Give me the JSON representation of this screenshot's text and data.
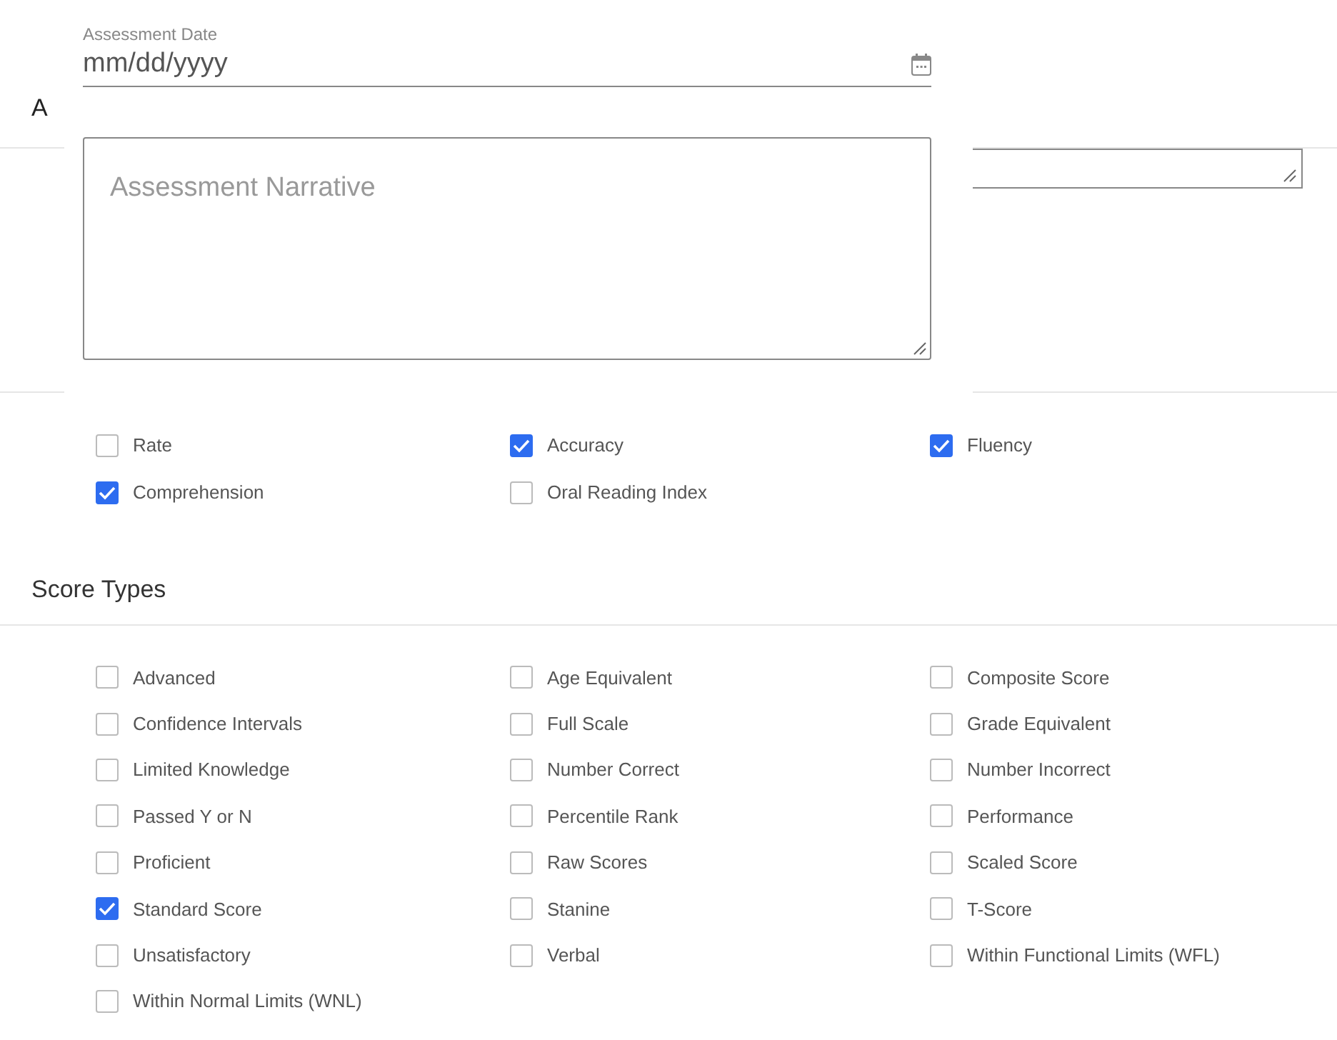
{
  "section_heading": "A",
  "date_field": {
    "label": "Assessment Date",
    "placeholder": "mm/dd/yyyy"
  },
  "narrative": {
    "placeholder": "Assessment Narrative"
  },
  "measures": [
    {
      "label": "Rate",
      "checked": false
    },
    {
      "label": "Accuracy",
      "checked": true
    },
    {
      "label": "Fluency",
      "checked": true
    },
    {
      "label": "Comprehension",
      "checked": true
    },
    {
      "label": "Oral Reading Index",
      "checked": false
    }
  ],
  "score_types": {
    "title": "Score Types",
    "items": [
      {
        "label": "Advanced",
        "checked": false
      },
      {
        "label": "Age Equivalent",
        "checked": false
      },
      {
        "label": "Composite Score",
        "checked": false
      },
      {
        "label": "Confidence Intervals",
        "checked": false
      },
      {
        "label": "Full Scale",
        "checked": false
      },
      {
        "label": "Grade Equivalent",
        "checked": false
      },
      {
        "label": "Limited Knowledge",
        "checked": false
      },
      {
        "label": "Number Correct",
        "checked": false
      },
      {
        "label": "Number Incorrect",
        "checked": false
      },
      {
        "label": "Passed Y or N",
        "checked": false
      },
      {
        "label": "Percentile Rank",
        "checked": false
      },
      {
        "label": "Performance",
        "checked": false
      },
      {
        "label": "Proficient",
        "checked": false
      },
      {
        "label": "Raw Scores",
        "checked": false
      },
      {
        "label": "Scaled Score",
        "checked": false
      },
      {
        "label": "Standard Score",
        "checked": true
      },
      {
        "label": "Stanine",
        "checked": false
      },
      {
        "label": "T-Score",
        "checked": false
      },
      {
        "label": "Unsatisfactory",
        "checked": false
      },
      {
        "label": "Verbal",
        "checked": false
      },
      {
        "label": "Within Functional Limits (WFL)",
        "checked": false
      },
      {
        "label": "Within Normal Limits (WNL)",
        "checked": false
      }
    ]
  }
}
